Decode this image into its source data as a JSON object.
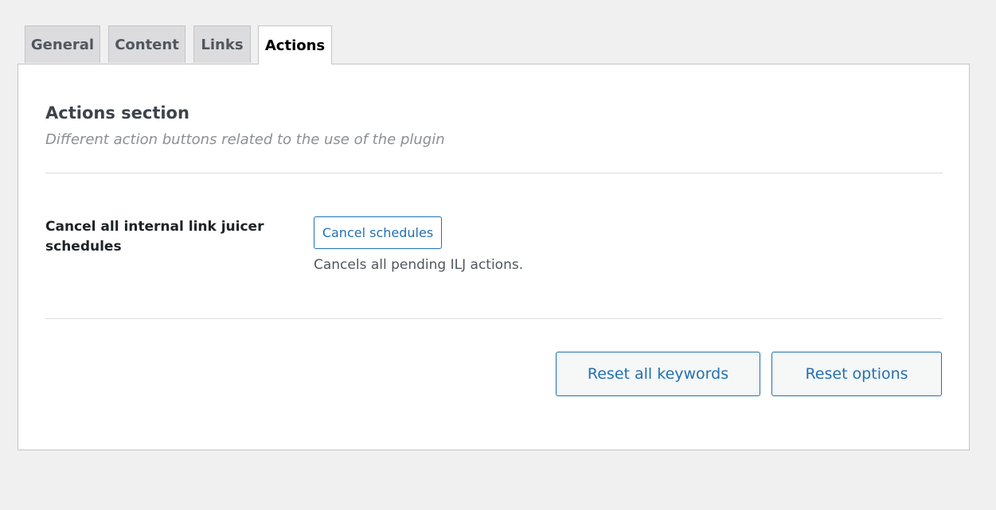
{
  "tabs": [
    {
      "label": "General",
      "active": false
    },
    {
      "label": "Content",
      "active": false
    },
    {
      "label": "Links",
      "active": false
    },
    {
      "label": "Actions",
      "active": true
    }
  ],
  "section": {
    "title": "Actions section",
    "description": "Different action buttons related to the use of the plugin"
  },
  "cancel_row": {
    "label": "Cancel all internal link juicer schedules",
    "button_label": "Cancel schedules",
    "description": "Cancels all pending ILJ actions."
  },
  "footer_buttons": {
    "reset_keywords_label": "Reset all keywords",
    "reset_options_label": "Reset options"
  },
  "colors": {
    "accent": "#2271b1",
    "page_background": "#f0f0f1",
    "panel_background": "#ffffff",
    "inactive_tab": "#dcdcde",
    "border": "#c3c4c7"
  }
}
